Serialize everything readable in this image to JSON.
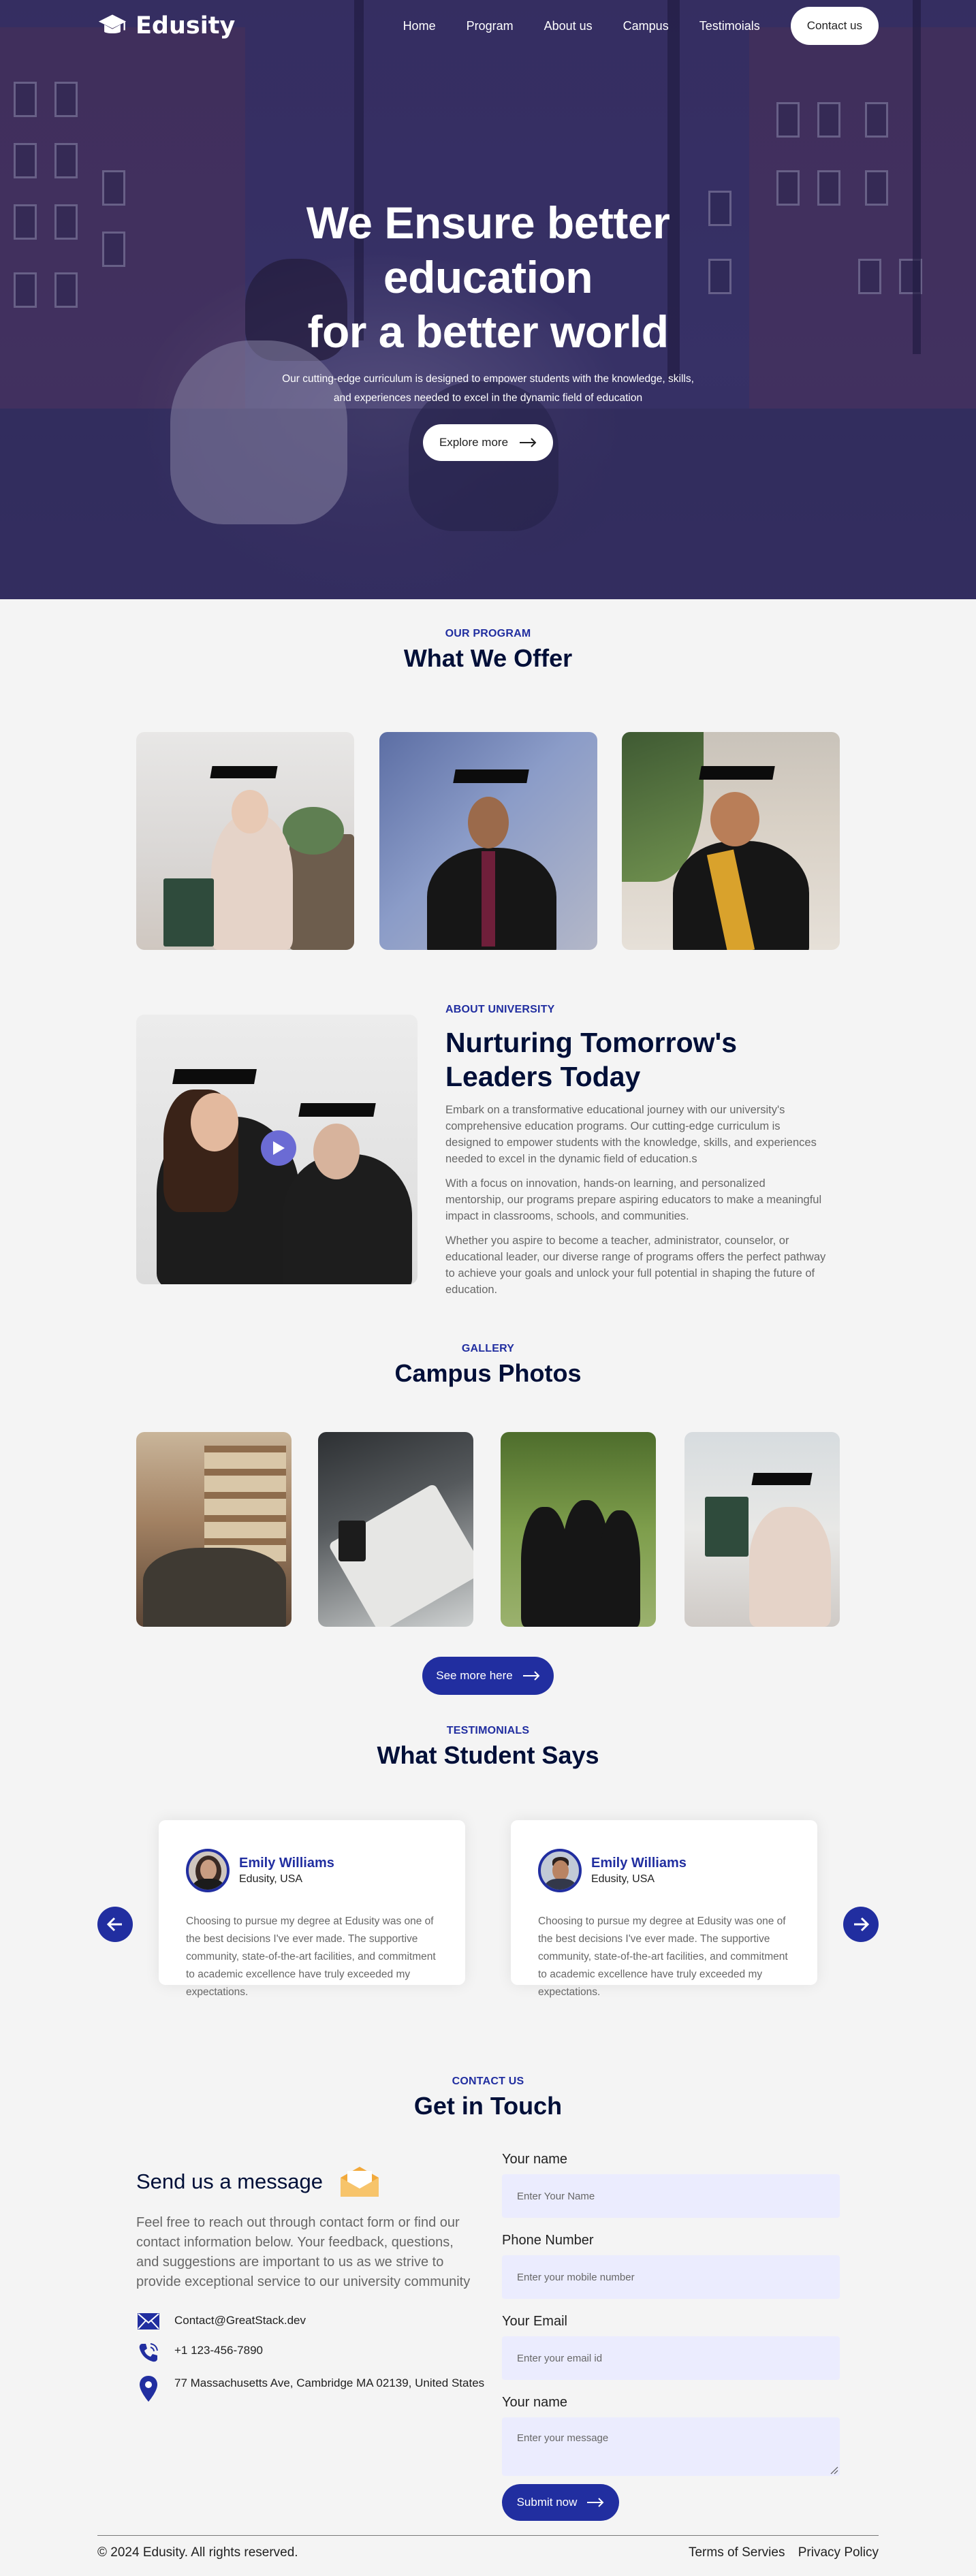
{
  "brand": {
    "name": "Edusity",
    "primary_color": "#212ea0",
    "dark_color": "#000f38"
  },
  "nav": {
    "items": [
      "Home",
      "Program",
      "About us",
      "Campus",
      "Testimoials"
    ],
    "contact_button": "Contact us"
  },
  "hero": {
    "title_line1": "We Ensure better education",
    "title_line2": "for a better world",
    "description_line1": "Our cutting-edge curriculum is designed to empower students with the knowledge, skills,",
    "description_line2": "and experiences needed to excel in the dynamic field of education",
    "button": "Explore more",
    "button_icon": "arrow-right-icon"
  },
  "program": {
    "subtitle": "OUR PROGRAM",
    "title": "What We Offer"
  },
  "about": {
    "subtitle": "ABOUT UNIVERSITY",
    "title_line1": "Nurturing Tomorrow's",
    "title_line2": "Leaders Today",
    "paragraphs": [
      "Embark on a transformative educational journey with our university's comprehensive education programs. Our cutting-edge curriculum is designed to empower students with the knowledge, skills, and experiences needed to excel in the dynamic field of education.s",
      "With a focus on innovation, hands-on learning, and personalized mentorship, our programs prepare aspiring educators to make a meaningful impact in classrooms, schools, and communities.",
      "Whether you aspire to become a teacher, administrator, counselor, or educational leader, our diverse range of programs offers the perfect pathway to achieve your goals and unlock your full potential in shaping the future of education."
    ],
    "play_icon": "play-icon"
  },
  "gallery": {
    "subtitle": "GALLERY",
    "title": "Campus Photos",
    "button": "See more here"
  },
  "testimonials": {
    "subtitle": "TESTIMONIALS",
    "title": "What Student Says",
    "items": [
      {
        "name": "Emily Williams",
        "location": "Edusity, USA",
        "quote": "Choosing to pursue my degree at Edusity was one of the best decisions I've ever made. The supportive community, state-of-the-art facilities, and commitment to academic excellence have truly exceeded my expectations."
      },
      {
        "name": "Emily Williams",
        "location": "Edusity, USA",
        "quote": "Choosing to pursue my degree at Edusity was one of the best decisions I've ever made. The supportive community, state-of-the-art facilities, and commitment to academic excellence have truly exceeded my expectations."
      }
    ]
  },
  "contact": {
    "subtitle": "CONTACT US",
    "title": "Get in Touch",
    "heading": "Send us a message",
    "lead": "Feel free to reach out through contact form or find our contact information below. Your feedback, questions, and suggestions are important to us as we strive to provide exceptional service to our university community",
    "email": "Contact@GreatStack.dev",
    "phone": "+1 123-456-7890",
    "address": "77 Massachusetts Ave, Cambridge MA 02139, United States",
    "form": {
      "name_label": "Your name",
      "name_placeholder": "Enter Your Name",
      "phone_label": "Phone Number",
      "phone_placeholder": "Enter your mobile number",
      "email_label": "Your Email",
      "email_placeholder": "Enter your email id",
      "message_label": "Your name",
      "message_placeholder": "Enter your message",
      "submit": "Submit now"
    }
  },
  "footer": {
    "copyright": "© 2024 Edusity. All rights reserved.",
    "links": [
      "Terms of Servies",
      "Privacy Policy"
    ]
  }
}
